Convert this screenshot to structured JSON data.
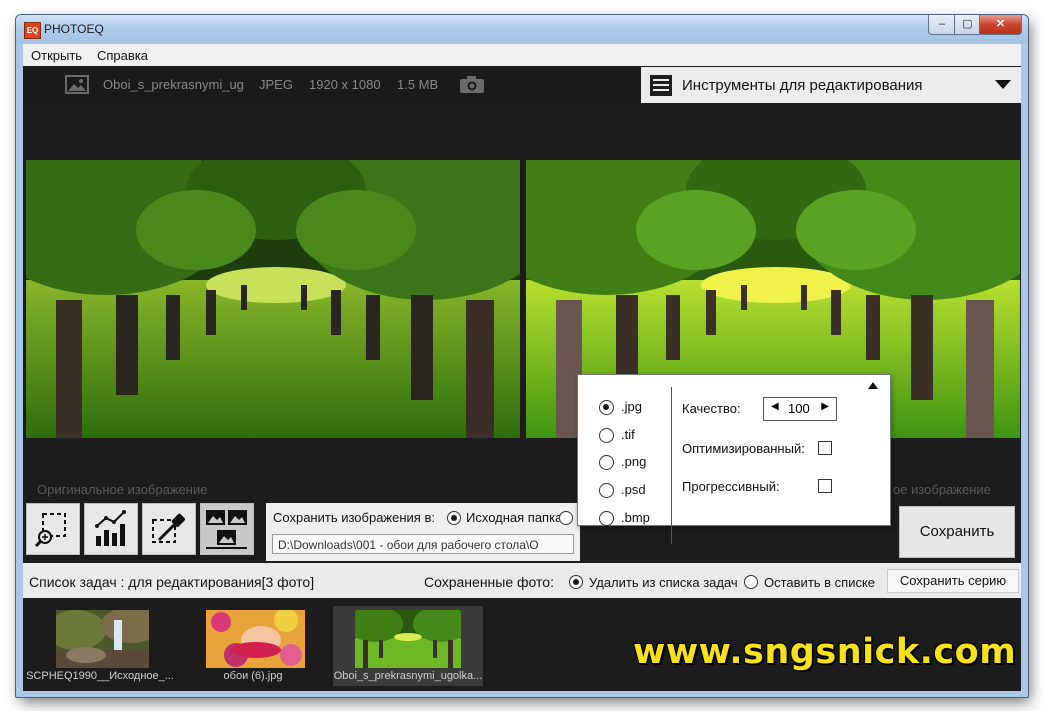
{
  "window": {
    "title": "PHOTOEQ",
    "icon_text": "EQ",
    "buttons": {
      "minimize": "–",
      "maximize": "▢",
      "close": "✕"
    }
  },
  "menu": [
    "Открыть",
    "Справка"
  ],
  "file_info": {
    "name": "Oboi_s_prekrasnymi_ug",
    "format": "JPEG",
    "resolution": "1920 x 1080",
    "size": "1.5 MB"
  },
  "tools_dropdown": {
    "label": "Инструменты для редактирования"
  },
  "captions": {
    "original": "Оригинальное изображение",
    "result_partial": "ое изображение"
  },
  "save": {
    "label": "Сохранить изображения в:",
    "source_option": "Исходная папка",
    "path": "D:\\Downloads\\001 - обои для рабочего стола\\O",
    "button": "Сохранить"
  },
  "format_popup": {
    "formats": [
      ".jpg",
      ".tif",
      ".png",
      ".psd",
      ".bmp"
    ],
    "selected_format": ".jpg",
    "quality_label": "Качество:",
    "quality_value": "100",
    "optimized_label": "Оптимизированный:",
    "progressive_label": "Прогрессивный:",
    "optimized": false,
    "progressive": false
  },
  "tasks": {
    "title": "Список задач : для редактирования[3 фото]",
    "saved_label": "Сохраненные фото:",
    "option_remove": "Удалить из списка задач",
    "option_keep": "Оставить в списке",
    "selected_option": "remove",
    "save_series": "Сохранить серию",
    "thumbnails": [
      {
        "caption": "SCPHEQ1990__Исходное_..."
      },
      {
        "caption": "обои (6).jpg"
      },
      {
        "caption": "Oboi_s_prekrasnymi_ugolka..."
      }
    ]
  },
  "watermark": "www.sngsnick.com"
}
